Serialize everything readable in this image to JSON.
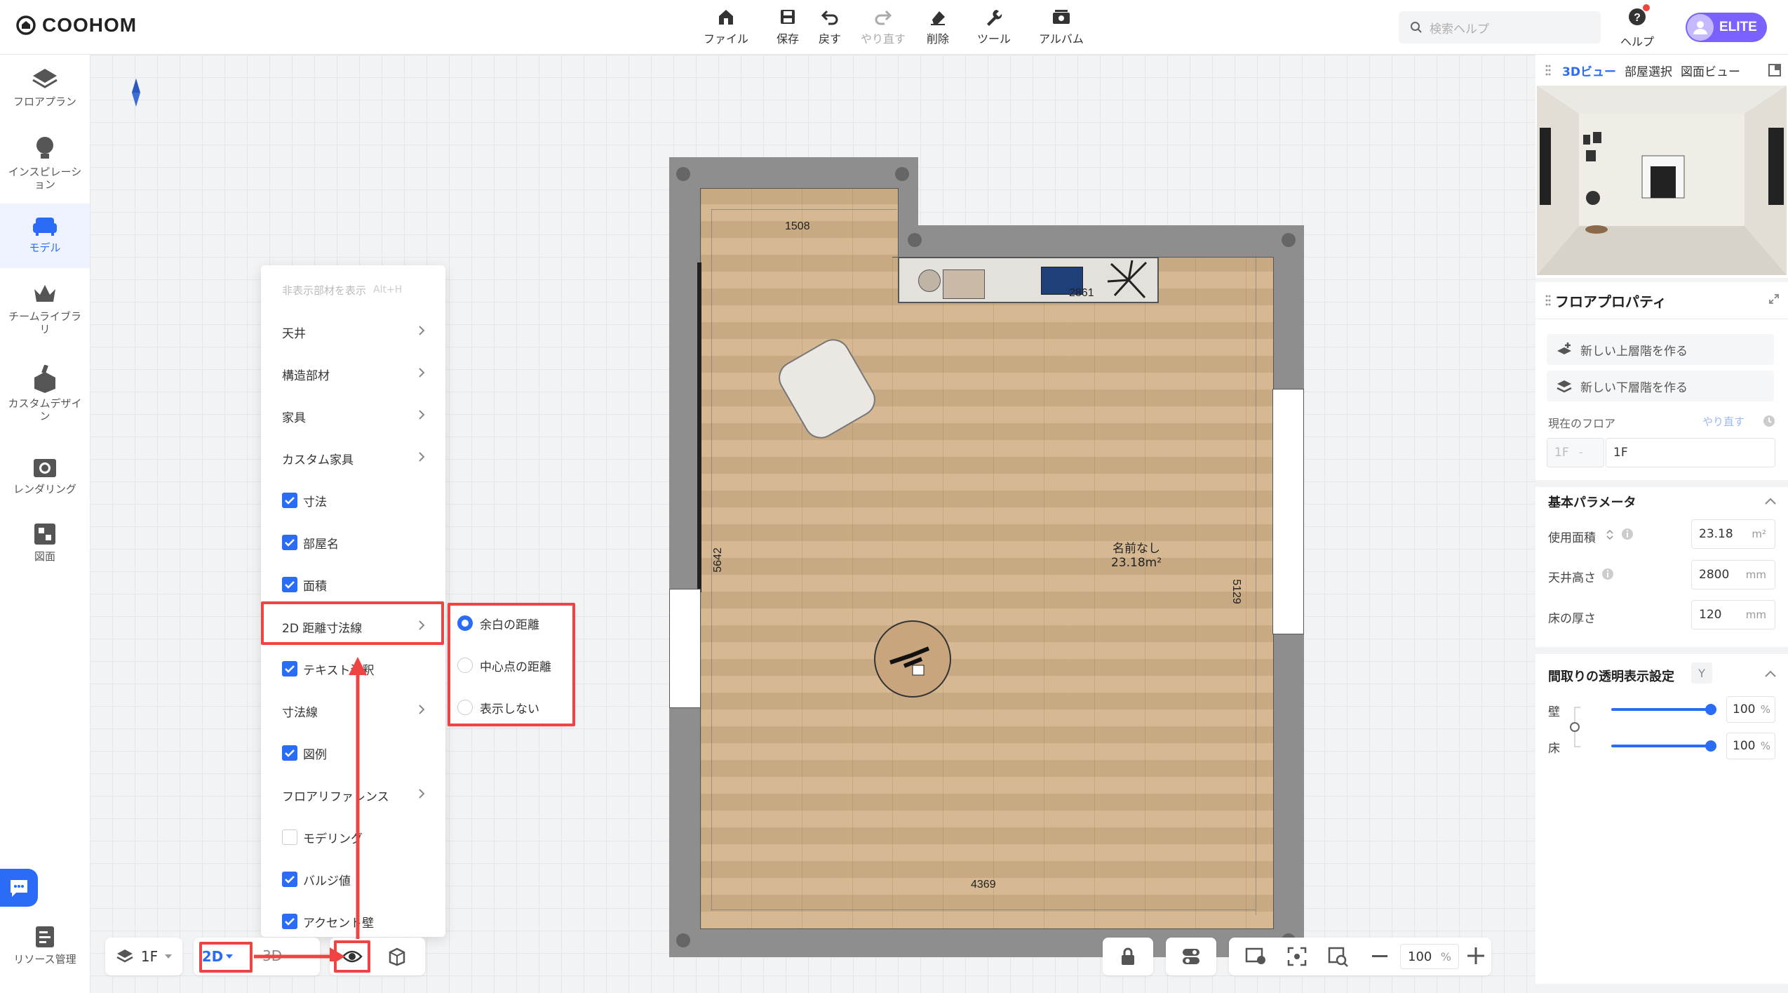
{
  "app": {
    "logo": "COOHOM"
  },
  "toolbar": [
    {
      "label": "ファイル",
      "icon": "home-file-icon"
    },
    {
      "label": "保存",
      "icon": "save-icon"
    },
    {
      "label": "戻す",
      "icon": "undo-icon"
    },
    {
      "label": "やり直す",
      "icon": "redo-icon"
    },
    {
      "label": "削除",
      "icon": "eraser-icon"
    },
    {
      "label": "ツール",
      "icon": "wrench-icon"
    },
    {
      "label": "アルバム",
      "icon": "album-icon"
    }
  ],
  "search": {
    "placeholder": "検索ヘルプ"
  },
  "help": {
    "label": "ヘルプ"
  },
  "user": {
    "badge": "ELITE"
  },
  "sidebar": {
    "items": [
      {
        "label": "フロアプラン",
        "icon": "floorplan-icon"
      },
      {
        "label": "インスピレーション",
        "icon": "lightbulb-icon"
      },
      {
        "label": "モデル",
        "icon": "sofa-icon",
        "active": true
      },
      {
        "label": "チームライブラリ",
        "icon": "crown-icon"
      },
      {
        "label": "カスタムデザイン",
        "icon": "custom-design-icon"
      },
      {
        "label": "レンダリング",
        "icon": "camera-icon"
      },
      {
        "label": "図面",
        "icon": "drawing-icon"
      }
    ],
    "bottom_label": "リソース管理"
  },
  "plan": {
    "dims": {
      "top_left": "1508",
      "top_right": "2861",
      "left": "5642",
      "right": "5129",
      "bottom": "4369"
    },
    "room_name": "名前なし",
    "room_area": "23.18m²"
  },
  "menu": {
    "header": "非表示部材を表示",
    "header_shortcut": "Alt+H",
    "items": [
      {
        "label": "天井",
        "type": "sub"
      },
      {
        "label": "構造部材",
        "type": "sub"
      },
      {
        "label": "家具",
        "type": "sub"
      },
      {
        "label": "カスタム家具",
        "type": "sub"
      },
      {
        "label": "寸法",
        "type": "check",
        "checked": true
      },
      {
        "label": "部屋名",
        "type": "check",
        "checked": true
      },
      {
        "label": "面積",
        "type": "check",
        "checked": true
      },
      {
        "label": "2D 距離寸法線",
        "type": "sub"
      },
      {
        "label": "テキスト注釈",
        "type": "check",
        "checked": true
      },
      {
        "label": "寸法線",
        "type": "sub"
      },
      {
        "label": "図例",
        "type": "check",
        "checked": true
      },
      {
        "label": "フロアリファレンス",
        "type": "sub"
      },
      {
        "label": "モデリング",
        "type": "check",
        "checked": false
      },
      {
        "label": "バルジ値",
        "type": "check",
        "checked": true
      },
      {
        "label": "アクセント壁",
        "type": "check",
        "checked": true
      }
    ]
  },
  "submenu": {
    "options": [
      {
        "label": "余白の距離",
        "selected": true
      },
      {
        "label": "中心点の距離",
        "selected": false
      },
      {
        "label": "表示しない",
        "selected": false
      }
    ]
  },
  "bottombar": {
    "floor": "1F",
    "mode_2d": "2D",
    "mode_3d": "3D",
    "zoom": "100",
    "zoom_unit": "%"
  },
  "viewpanel": {
    "tabs": [
      "3Dビュー",
      "部屋選択",
      "図面ビュー"
    ],
    "active_tab": 0
  },
  "props": {
    "title": "フロアプロパティ",
    "btn_upper": "新しい上層階を作る",
    "btn_lower": "新しい下層階を作る",
    "current_floor_label": "現在のフロア",
    "redo_link": "やり直す",
    "floor_prefix": "1F",
    "floor_value": "1F",
    "basic_params": "基本パラメータ",
    "area_label": "使用面積",
    "area_value": "23.18",
    "area_unit": "m²",
    "ceiling_label": "天井高さ",
    "ceiling_value": "2800",
    "ceiling_unit": "mm",
    "floor_thick_label": "床の厚さ",
    "floor_thick_value": "120",
    "floor_thick_unit": "mm",
    "transparency_title": "間取りの透明表示設定",
    "transparency_shortcut": "Y",
    "wall_label": "壁",
    "wall_value": "100",
    "floor_label": "床",
    "floor_opacity_value": "100",
    "percent": "%",
    "wall_opacity": 1.0,
    "floor_opacity": 1.0
  },
  "colors": {
    "accent": "#2a6cf6",
    "highlight": "#ef4444",
    "elite": "#7b61ff"
  }
}
